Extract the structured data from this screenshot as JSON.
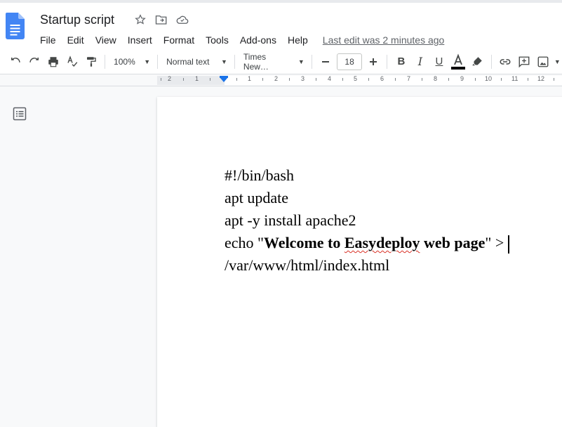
{
  "doc": {
    "title": "Startup script"
  },
  "menu": {
    "items": [
      "File",
      "Edit",
      "View",
      "Insert",
      "Format",
      "Tools",
      "Add-ons",
      "Help"
    ],
    "last_edit": "Last edit was 2 minutes ago"
  },
  "toolbar": {
    "zoom": "100%",
    "style": "Normal text",
    "font": "Times New…",
    "font_size": "18",
    "text_color": "#000000"
  },
  "ruler": {
    "labels": [
      "2",
      "1",
      "1",
      "2",
      "3",
      "4",
      "5",
      "6",
      "7",
      "8",
      "9",
      "10",
      "11",
      "12"
    ]
  },
  "body": {
    "line1": "#!/bin/bash",
    "line2": "apt update",
    "line3": "apt -y install apache2",
    "line4_prefix": "echo \"",
    "line4_bold1": "Welcome to ",
    "line4_bold_misspelled": "Easydeploy",
    "line4_bold2": " web page",
    "line4_suffix": "\" >",
    "line5": "/var/www/html/index.html"
  },
  "colors": {
    "accent": "#1a73e8",
    "doc_blue": "#4285f4",
    "spell_error": "#d93025"
  }
}
